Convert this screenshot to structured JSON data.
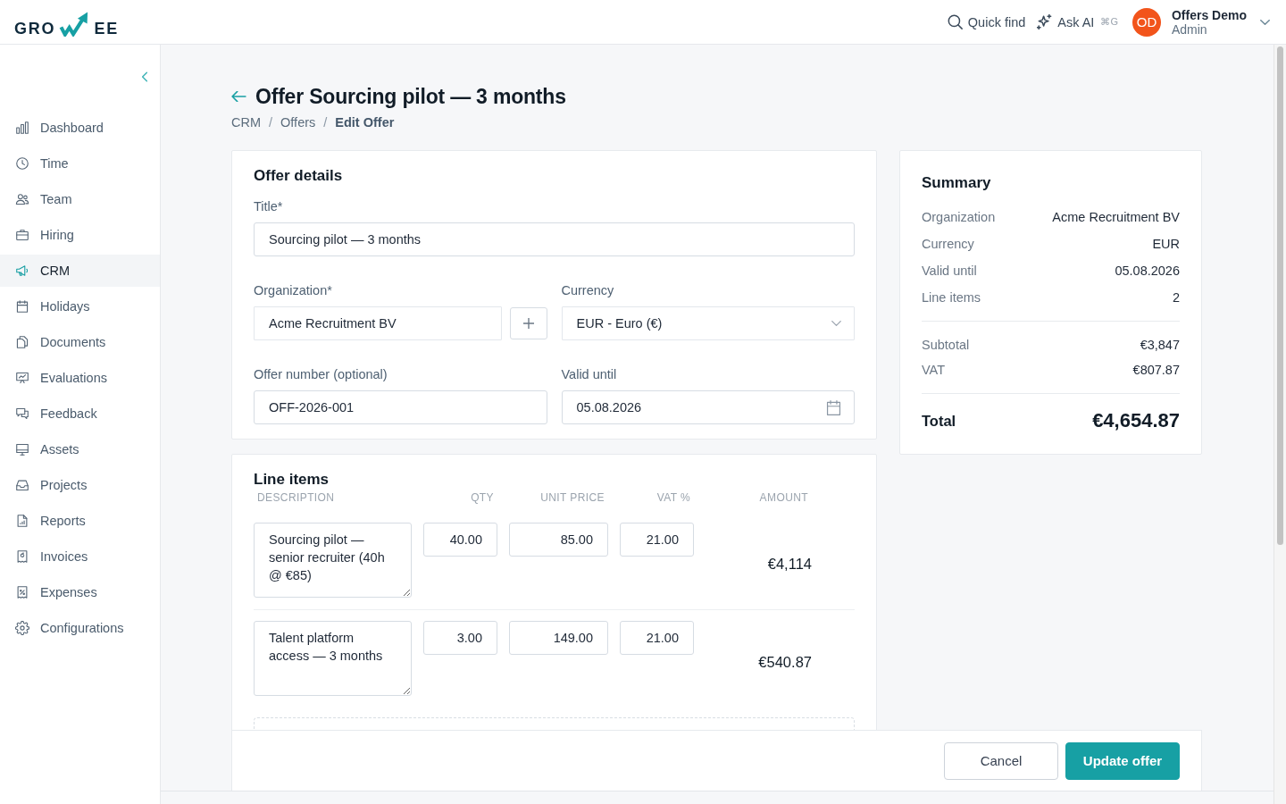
{
  "topbar": {
    "logo": {
      "left": "GRO",
      "right": "EE"
    },
    "quick_find": "Quick find",
    "ask_ai": {
      "label": "Ask AI",
      "shortcut": "⌘G"
    },
    "user": {
      "initials": "OD",
      "name": "Offers Demo",
      "role": "Admin"
    }
  },
  "sidebar": {
    "items": [
      {
        "label": "Dashboard",
        "selected": false
      },
      {
        "label": "Time",
        "selected": false
      },
      {
        "label": "Team",
        "selected": false
      },
      {
        "label": "Hiring",
        "selected": false
      },
      {
        "label": "CRM",
        "selected": true
      },
      {
        "label": "Holidays",
        "selected": false
      },
      {
        "label": "Documents",
        "selected": false
      },
      {
        "label": "Evaluations",
        "selected": false
      },
      {
        "label": "Feedback",
        "selected": false
      },
      {
        "label": "Assets",
        "selected": false
      },
      {
        "label": "Projects",
        "selected": false
      },
      {
        "label": "Reports",
        "selected": false
      },
      {
        "label": "Invoices",
        "selected": false
      },
      {
        "label": "Expenses",
        "selected": false
      },
      {
        "label": "Configurations",
        "selected": false
      }
    ]
  },
  "header": {
    "title": "Offer Sourcing pilot — 3 months",
    "breadcrumb": [
      {
        "label": "CRM",
        "current": false,
        "separator": "/"
      },
      {
        "label": "Offers",
        "current": false,
        "separator": "/"
      },
      {
        "label": "Edit Offer",
        "current": true
      }
    ]
  },
  "offer_details": {
    "heading": "Offer details",
    "title_field": {
      "label": "Title*",
      "value": "Sourcing pilot — 3 months"
    },
    "organization": {
      "label": "Organization*",
      "value": "Acme Recruitment BV"
    },
    "currency": {
      "label": "Currency",
      "value": "EUR - Euro (€)"
    },
    "offer_number": {
      "label": "Offer number (optional)",
      "value": "OFF-2026-001"
    },
    "valid_until": {
      "label": "Valid until",
      "value": "05.08.2026"
    }
  },
  "line_items": {
    "heading": "Line items",
    "columns": [
      "DESCRIPTION",
      "QTY",
      "UNIT PRICE",
      "VAT %",
      "AMOUNT"
    ],
    "rows": [
      {
        "description": "Sourcing pilot — senior recruiter (40h @ €85)",
        "qty": "40.00",
        "unit_price": "85.00",
        "vat": "21.00",
        "amount": "€4,114"
      },
      {
        "description": "Talent platform access — 3 months",
        "qty": "3.00",
        "unit_price": "149.00",
        "vat": "21.00",
        "amount": "€540.87"
      }
    ]
  },
  "summary": {
    "heading": "Summary",
    "details": [
      {
        "label": "Organization",
        "value": "Acme Recruitment BV"
      },
      {
        "label": "Currency",
        "value": "EUR"
      },
      {
        "label": "Valid until",
        "value": "05.08.2026"
      },
      {
        "label": "Line items",
        "value": "2"
      }
    ],
    "totals": [
      {
        "label": "Subtotal",
        "value": "€3,847"
      },
      {
        "label": "VAT",
        "value": "€807.87"
      }
    ],
    "total": {
      "label": "Total",
      "value": "€4,654.87"
    }
  },
  "footer": {
    "buttons": [
      {
        "label": "Cancel",
        "kind": "secondary"
      },
      {
        "label": "Update offer",
        "kind": "primary"
      }
    ]
  }
}
